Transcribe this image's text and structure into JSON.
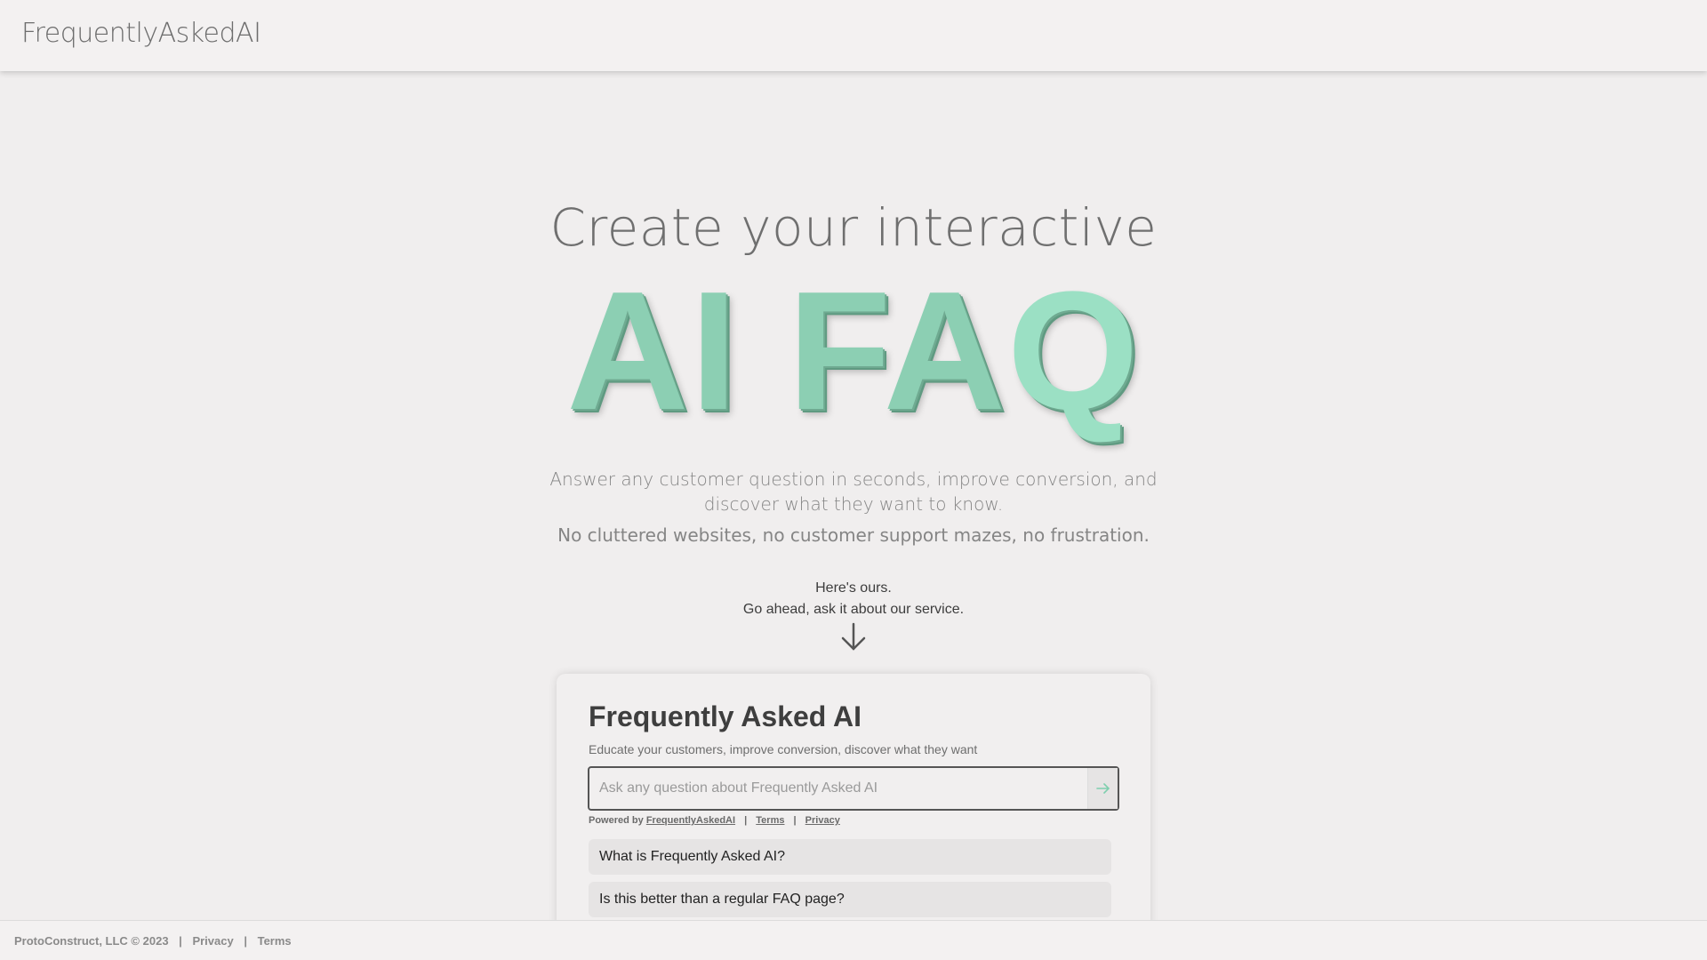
{
  "header": {
    "brand": "FrequentlyAskedAI"
  },
  "hero": {
    "line1": "Create your interactive",
    "big_part1": "AI FA",
    "big_part2": "Q",
    "tagline1": "Answer any customer question in seconds, improve conversion, and discover what they want to know.",
    "tagline2": "No cluttered websites, no customer support mazes, no frustration.",
    "heres_line1": "Here's ours.",
    "heres_line2": "Go ahead, ask it about our service."
  },
  "widget": {
    "title": "Frequently Asked AI",
    "subtitle": "Educate your customers, improve conversion, discover what they want",
    "search_placeholder": "Ask any question about Frequently Asked AI",
    "powered_prefix": "Powered by",
    "powered_link": "FrequentlyAskedAI",
    "terms": "Terms",
    "privacy": "Privacy",
    "faq": [
      "What is Frequently Asked AI?",
      "Is this better than a regular FAQ page?"
    ]
  },
  "footer": {
    "copyright": "ProtoConstruct, LLC © 2023",
    "privacy": "Privacy",
    "terms": "Terms"
  },
  "colors": {
    "accent": "#8ccfb3",
    "background": "#f0eeee"
  }
}
